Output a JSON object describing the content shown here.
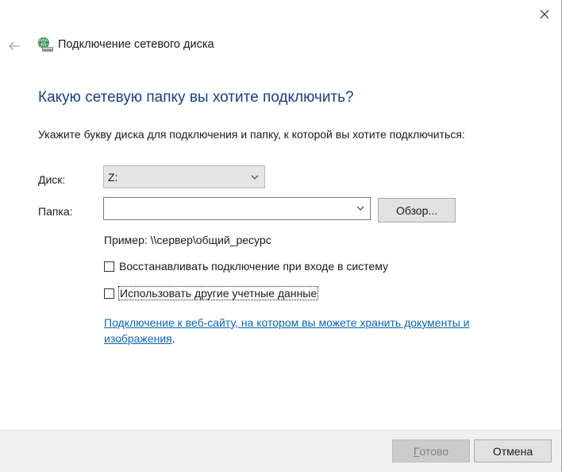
{
  "window": {
    "title": "Подключение сетевого диска",
    "close_icon": "close-icon",
    "back_icon": "back-arrow-icon",
    "title_icon": "network-drive-icon"
  },
  "content": {
    "heading": "Какую сетевую папку вы хотите подключить?",
    "instruction": "Укажите букву диска для подключения и папку, к которой вы хотите подключиться:",
    "drive": {
      "label": "Диск:",
      "selected": "Z:"
    },
    "folder": {
      "label": "Папка:",
      "value": "",
      "placeholder": ""
    },
    "browse_label": "Обзор...",
    "example": "Пример: \\\\сервер\\общий_ресурс",
    "reconnect": {
      "label": "Восстанавливать подключение при входе в систему",
      "checked": false
    },
    "other_credentials": {
      "label": "Использовать другие учетные данные",
      "checked": false
    },
    "website_link": "Подключение к веб-сайту, на котором вы можете хранить документы и изображения",
    "website_link_suffix": "."
  },
  "footer": {
    "done_first": "Г",
    "done_rest": "отово",
    "cancel_label": "Отмена"
  },
  "colors": {
    "heading": "#1a3f8a",
    "link": "#0a66b8",
    "footer_bg": "#f0f0f0"
  }
}
